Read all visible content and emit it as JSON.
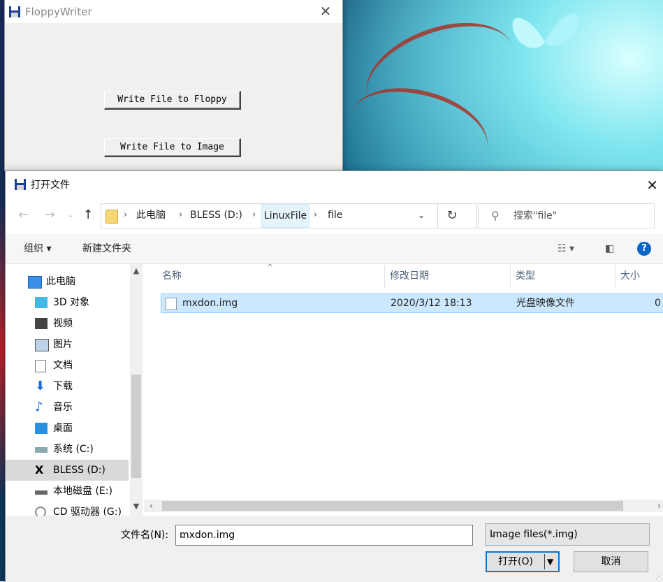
{
  "floppywriter": {
    "title": "FloppyWriter",
    "buttons": {
      "write_floppy": "Write File to Floppy",
      "write_image": "Write File to Image"
    }
  },
  "dialog": {
    "title": "打开文件",
    "breadcrumb": [
      "此电脑",
      "BLESS (D:)",
      "LinuxFile",
      "file"
    ],
    "search_placeholder": "搜索\"file\"",
    "toolbar": {
      "organize": "组织 ▾",
      "new_folder": "新建文件夹"
    },
    "tree": [
      {
        "label": "此电脑",
        "icon": "computer-icon"
      },
      {
        "label": "3D 对象",
        "icon": "3d-objects-icon"
      },
      {
        "label": "视频",
        "icon": "video-icon"
      },
      {
        "label": "图片",
        "icon": "pictures-icon"
      },
      {
        "label": "文档",
        "icon": "documents-icon"
      },
      {
        "label": "下载",
        "icon": "download-icon"
      },
      {
        "label": "音乐",
        "icon": "music-icon"
      },
      {
        "label": "桌面",
        "icon": "desktop-icon"
      },
      {
        "label": "系统 (C:)",
        "icon": "drive-icon"
      },
      {
        "label": "BLESS (D:)",
        "icon": "bless-drive-icon",
        "selected": true
      },
      {
        "label": "本地磁盘 (E:)",
        "icon": "drive-icon"
      },
      {
        "label": "CD 驱动器 (G:)",
        "icon": "cd-drive-icon"
      }
    ],
    "columns": {
      "name": "名称",
      "modified": "修改日期",
      "type": "类型",
      "size": "大小"
    },
    "files": [
      {
        "name": "mxdon.img",
        "modified": "2020/3/12 18:13",
        "type": "光盘映像文件",
        "size": "0"
      }
    ],
    "filename_label": "文件名(N):",
    "filename_value": "mxdon.img",
    "filter": "Image files(*.img)",
    "open_label": "打开(O)",
    "cancel_label": "取消"
  },
  "colors": {
    "accent": "#0078d7",
    "selection": "#cce8ff",
    "help": "#0b63c4"
  }
}
